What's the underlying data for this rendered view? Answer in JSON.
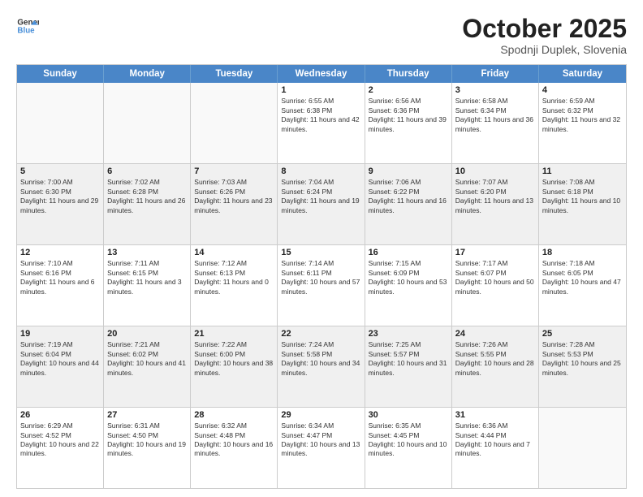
{
  "header": {
    "logo_line1": "General",
    "logo_line2": "Blue",
    "month": "October 2025",
    "location": "Spodnji Duplek, Slovenia"
  },
  "weekdays": [
    "Sunday",
    "Monday",
    "Tuesday",
    "Wednesday",
    "Thursday",
    "Friday",
    "Saturday"
  ],
  "rows": [
    [
      {
        "day": "",
        "info": "",
        "shaded": false,
        "empty": true
      },
      {
        "day": "",
        "info": "",
        "shaded": false,
        "empty": true
      },
      {
        "day": "",
        "info": "",
        "shaded": false,
        "empty": true
      },
      {
        "day": "1",
        "info": "Sunrise: 6:55 AM\nSunset: 6:38 PM\nDaylight: 11 hours and 42 minutes.",
        "shaded": false,
        "empty": false
      },
      {
        "day": "2",
        "info": "Sunrise: 6:56 AM\nSunset: 6:36 PM\nDaylight: 11 hours and 39 minutes.",
        "shaded": false,
        "empty": false
      },
      {
        "day": "3",
        "info": "Sunrise: 6:58 AM\nSunset: 6:34 PM\nDaylight: 11 hours and 36 minutes.",
        "shaded": false,
        "empty": false
      },
      {
        "day": "4",
        "info": "Sunrise: 6:59 AM\nSunset: 6:32 PM\nDaylight: 11 hours and 32 minutes.",
        "shaded": false,
        "empty": false
      }
    ],
    [
      {
        "day": "5",
        "info": "Sunrise: 7:00 AM\nSunset: 6:30 PM\nDaylight: 11 hours and 29 minutes.",
        "shaded": true,
        "empty": false
      },
      {
        "day": "6",
        "info": "Sunrise: 7:02 AM\nSunset: 6:28 PM\nDaylight: 11 hours and 26 minutes.",
        "shaded": true,
        "empty": false
      },
      {
        "day": "7",
        "info": "Sunrise: 7:03 AM\nSunset: 6:26 PM\nDaylight: 11 hours and 23 minutes.",
        "shaded": true,
        "empty": false
      },
      {
        "day": "8",
        "info": "Sunrise: 7:04 AM\nSunset: 6:24 PM\nDaylight: 11 hours and 19 minutes.",
        "shaded": true,
        "empty": false
      },
      {
        "day": "9",
        "info": "Sunrise: 7:06 AM\nSunset: 6:22 PM\nDaylight: 11 hours and 16 minutes.",
        "shaded": true,
        "empty": false
      },
      {
        "day": "10",
        "info": "Sunrise: 7:07 AM\nSunset: 6:20 PM\nDaylight: 11 hours and 13 minutes.",
        "shaded": true,
        "empty": false
      },
      {
        "day": "11",
        "info": "Sunrise: 7:08 AM\nSunset: 6:18 PM\nDaylight: 11 hours and 10 minutes.",
        "shaded": true,
        "empty": false
      }
    ],
    [
      {
        "day": "12",
        "info": "Sunrise: 7:10 AM\nSunset: 6:16 PM\nDaylight: 11 hours and 6 minutes.",
        "shaded": false,
        "empty": false
      },
      {
        "day": "13",
        "info": "Sunrise: 7:11 AM\nSunset: 6:15 PM\nDaylight: 11 hours and 3 minutes.",
        "shaded": false,
        "empty": false
      },
      {
        "day": "14",
        "info": "Sunrise: 7:12 AM\nSunset: 6:13 PM\nDaylight: 11 hours and 0 minutes.",
        "shaded": false,
        "empty": false
      },
      {
        "day": "15",
        "info": "Sunrise: 7:14 AM\nSunset: 6:11 PM\nDaylight: 10 hours and 57 minutes.",
        "shaded": false,
        "empty": false
      },
      {
        "day": "16",
        "info": "Sunrise: 7:15 AM\nSunset: 6:09 PM\nDaylight: 10 hours and 53 minutes.",
        "shaded": false,
        "empty": false
      },
      {
        "day": "17",
        "info": "Sunrise: 7:17 AM\nSunset: 6:07 PM\nDaylight: 10 hours and 50 minutes.",
        "shaded": false,
        "empty": false
      },
      {
        "day": "18",
        "info": "Sunrise: 7:18 AM\nSunset: 6:05 PM\nDaylight: 10 hours and 47 minutes.",
        "shaded": false,
        "empty": false
      }
    ],
    [
      {
        "day": "19",
        "info": "Sunrise: 7:19 AM\nSunset: 6:04 PM\nDaylight: 10 hours and 44 minutes.",
        "shaded": true,
        "empty": false
      },
      {
        "day": "20",
        "info": "Sunrise: 7:21 AM\nSunset: 6:02 PM\nDaylight: 10 hours and 41 minutes.",
        "shaded": true,
        "empty": false
      },
      {
        "day": "21",
        "info": "Sunrise: 7:22 AM\nSunset: 6:00 PM\nDaylight: 10 hours and 38 minutes.",
        "shaded": true,
        "empty": false
      },
      {
        "day": "22",
        "info": "Sunrise: 7:24 AM\nSunset: 5:58 PM\nDaylight: 10 hours and 34 minutes.",
        "shaded": true,
        "empty": false
      },
      {
        "day": "23",
        "info": "Sunrise: 7:25 AM\nSunset: 5:57 PM\nDaylight: 10 hours and 31 minutes.",
        "shaded": true,
        "empty": false
      },
      {
        "day": "24",
        "info": "Sunrise: 7:26 AM\nSunset: 5:55 PM\nDaylight: 10 hours and 28 minutes.",
        "shaded": true,
        "empty": false
      },
      {
        "day": "25",
        "info": "Sunrise: 7:28 AM\nSunset: 5:53 PM\nDaylight: 10 hours and 25 minutes.",
        "shaded": true,
        "empty": false
      }
    ],
    [
      {
        "day": "26",
        "info": "Sunrise: 6:29 AM\nSunset: 4:52 PM\nDaylight: 10 hours and 22 minutes.",
        "shaded": false,
        "empty": false
      },
      {
        "day": "27",
        "info": "Sunrise: 6:31 AM\nSunset: 4:50 PM\nDaylight: 10 hours and 19 minutes.",
        "shaded": false,
        "empty": false
      },
      {
        "day": "28",
        "info": "Sunrise: 6:32 AM\nSunset: 4:48 PM\nDaylight: 10 hours and 16 minutes.",
        "shaded": false,
        "empty": false
      },
      {
        "day": "29",
        "info": "Sunrise: 6:34 AM\nSunset: 4:47 PM\nDaylight: 10 hours and 13 minutes.",
        "shaded": false,
        "empty": false
      },
      {
        "day": "30",
        "info": "Sunrise: 6:35 AM\nSunset: 4:45 PM\nDaylight: 10 hours and 10 minutes.",
        "shaded": false,
        "empty": false
      },
      {
        "day": "31",
        "info": "Sunrise: 6:36 AM\nSunset: 4:44 PM\nDaylight: 10 hours and 7 minutes.",
        "shaded": false,
        "empty": false
      },
      {
        "day": "",
        "info": "",
        "shaded": false,
        "empty": true
      }
    ]
  ]
}
